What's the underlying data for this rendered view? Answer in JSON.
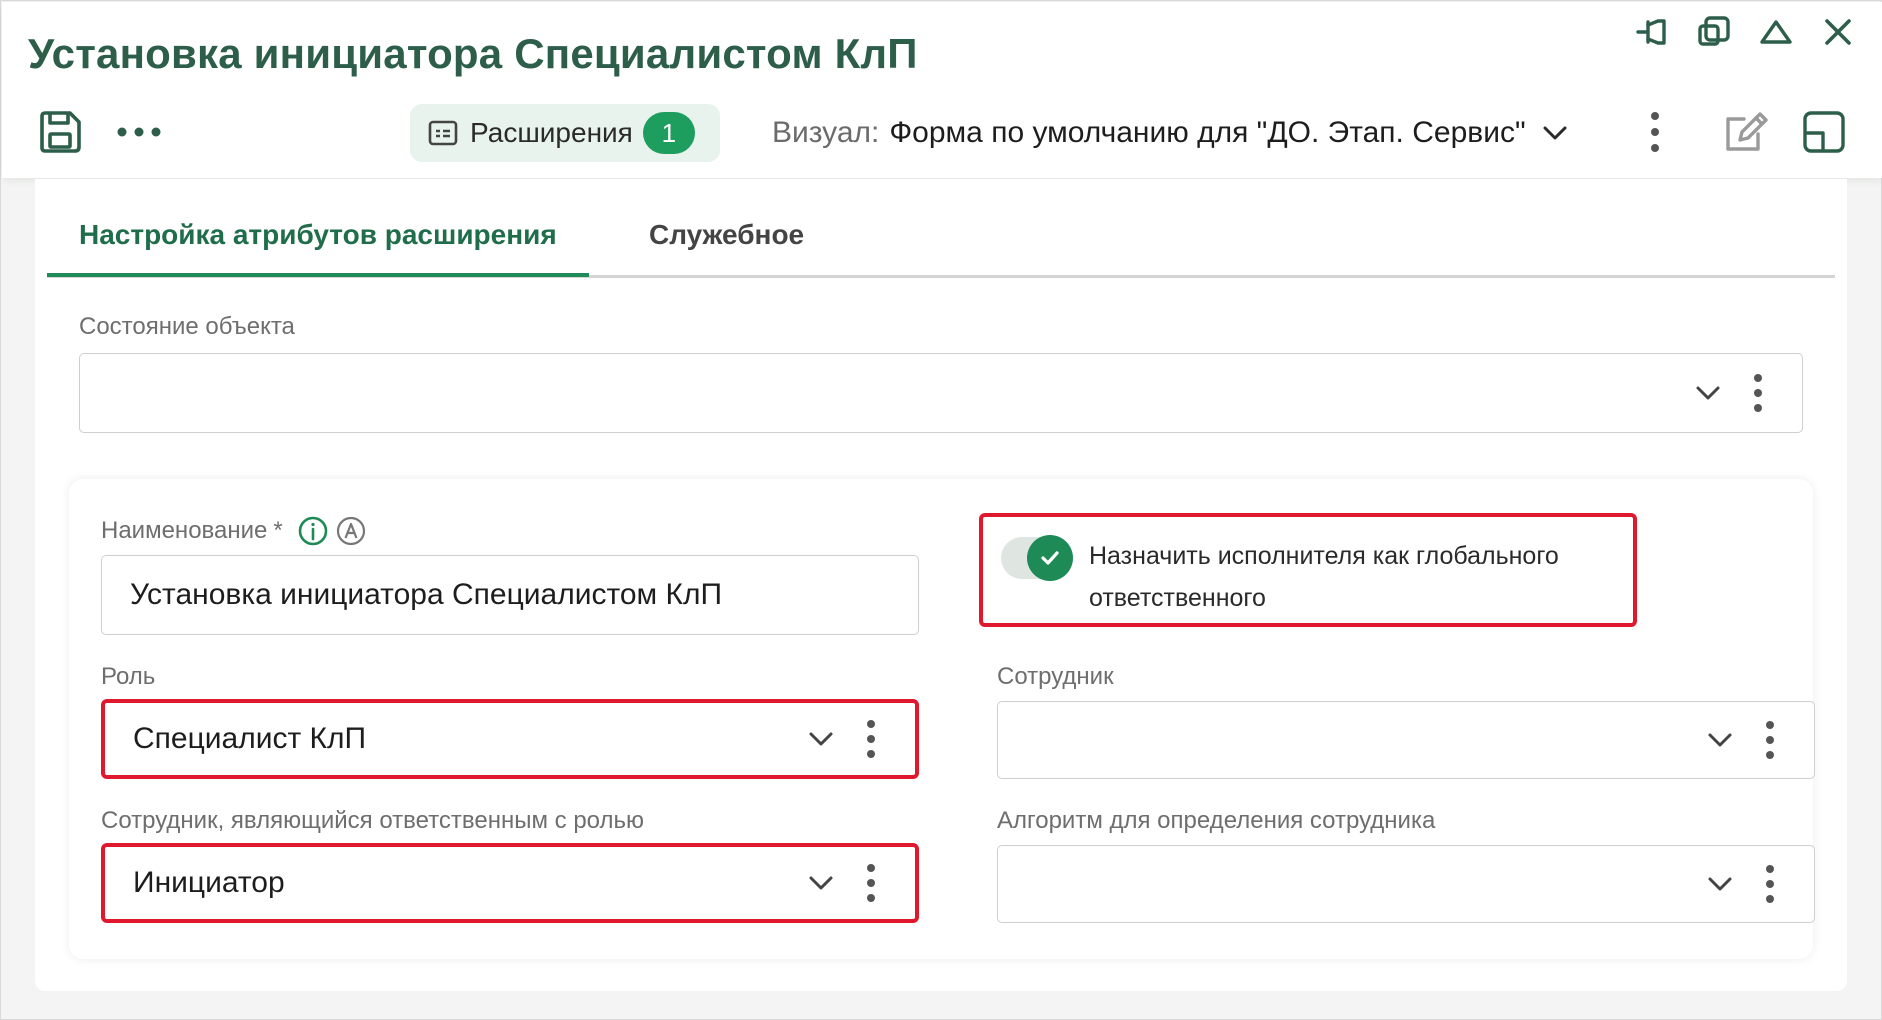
{
  "window": {
    "title": "Установка инициатора Специалистом КлП",
    "controls": [
      "pin-icon",
      "restore-icon",
      "collapse-icon",
      "close-icon"
    ]
  },
  "toolbar": {
    "extensions_label": "Расширения",
    "extensions_count": "1",
    "visual_label": "Визуал:",
    "visual_value": "Форма по умолчанию для \"ДО. Этап. Сервис\""
  },
  "tabs": [
    {
      "label": "Настройка атрибутов расширения",
      "active": true
    },
    {
      "label": "Служебное",
      "active": false
    }
  ],
  "form": {
    "object_state": {
      "label": "Состояние объекта",
      "value": ""
    },
    "name": {
      "label": "Наименование",
      "required_mark": "*",
      "value": "Установка инициатора Специалистом КлП"
    },
    "global_responsible": {
      "label": "Назначить исполнителя как глобального ответственного",
      "checked": true
    },
    "role": {
      "label": "Роль",
      "value": "Специалист КлП"
    },
    "employee": {
      "label": "Сотрудник",
      "value": ""
    },
    "responsible_employee": {
      "label": "Сотрудник, являющийся ответственным с ролью",
      "value": "Инициатор"
    },
    "algorithm": {
      "label": "Алгоритм для определения сотрудника",
      "value": ""
    }
  },
  "colors": {
    "accent": "#1f8a5a",
    "title": "#2c5e4a",
    "highlight": "#e0182d"
  }
}
